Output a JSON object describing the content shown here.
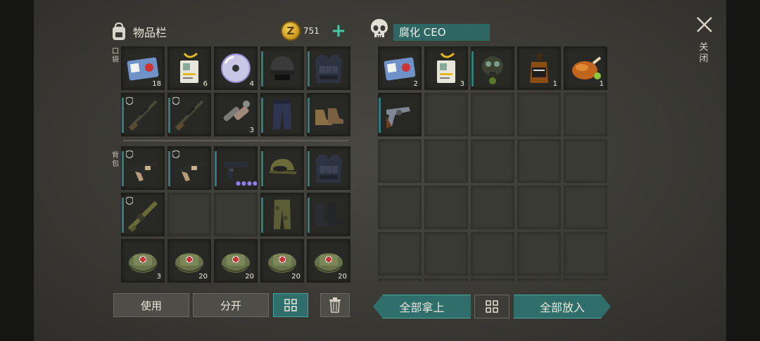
{
  "inventory": {
    "title": "物品栏",
    "coins": "751",
    "add_label": "+",
    "pocket_label": "口袋",
    "backpack_label": "背包",
    "pocket_slots": [
      {
        "icon": "biohazard-keycard-icon",
        "count": "18"
      },
      {
        "icon": "id-badge-icon",
        "count": "6"
      },
      {
        "icon": "cd-disc-icon",
        "count": "4"
      },
      {
        "icon": "combat-helmet-icon",
        "count": ""
      },
      {
        "icon": "tactical-vest-icon",
        "count": ""
      },
      {
        "icon": "sniper-rifle-icon",
        "count": ""
      },
      {
        "icon": "sniper-rifle-icon",
        "count": ""
      },
      {
        "icon": "pipe-parts-icon",
        "count": "3"
      },
      {
        "icon": "trousers-icon",
        "count": ""
      },
      {
        "icon": "boots-icon",
        "count": ""
      }
    ],
    "backpack_slots": [
      {
        "icon": "shotgun-icon",
        "count": ""
      },
      {
        "icon": "shotgun-icon",
        "count": ""
      },
      {
        "icon": "pistol-icon",
        "count": "",
        "dots": "●●●●"
      },
      {
        "icon": "camo-cap-icon",
        "count": ""
      },
      {
        "icon": "tactical-vest-icon",
        "count": ""
      },
      {
        "icon": "camo-rifle-icon",
        "count": ""
      },
      {
        "icon": "",
        "count": ""
      },
      {
        "icon": "",
        "count": ""
      },
      {
        "icon": "camo-pants-icon",
        "count": ""
      },
      {
        "icon": "combat-boots-icon",
        "count": ""
      },
      {
        "icon": "medkit-bag-icon",
        "count": "3"
      },
      {
        "icon": "medkit-bag-icon",
        "count": "20"
      },
      {
        "icon": "medkit-bag-icon",
        "count": "20"
      },
      {
        "icon": "medkit-bag-icon",
        "count": "20"
      },
      {
        "icon": "medkit-bag-icon",
        "count": "20"
      }
    ],
    "buttons": {
      "use": "使用",
      "split": "分开",
      "sort": "",
      "trash": ""
    }
  },
  "loot": {
    "title": "腐化 CEO",
    "slots": [
      {
        "icon": "biohazard-keycard-icon",
        "count": "2"
      },
      {
        "icon": "id-badge-icon",
        "count": "3"
      },
      {
        "icon": "gas-mask-icon",
        "count": ""
      },
      {
        "icon": "whiskey-bottle-icon",
        "count": "1"
      },
      {
        "icon": "roast-chicken-icon",
        "count": "1"
      },
      {
        "icon": "revolver-icon",
        "count": ""
      }
    ],
    "buttons": {
      "take_all": "全部拿上",
      "put_all": "全部放入"
    }
  },
  "close_label": "关闭",
  "colors": {
    "accent_teal": "#2f6e6b",
    "plus_green": "#41c9a8",
    "panel_bg": "#42413b",
    "slot_bg": "#282824"
  }
}
